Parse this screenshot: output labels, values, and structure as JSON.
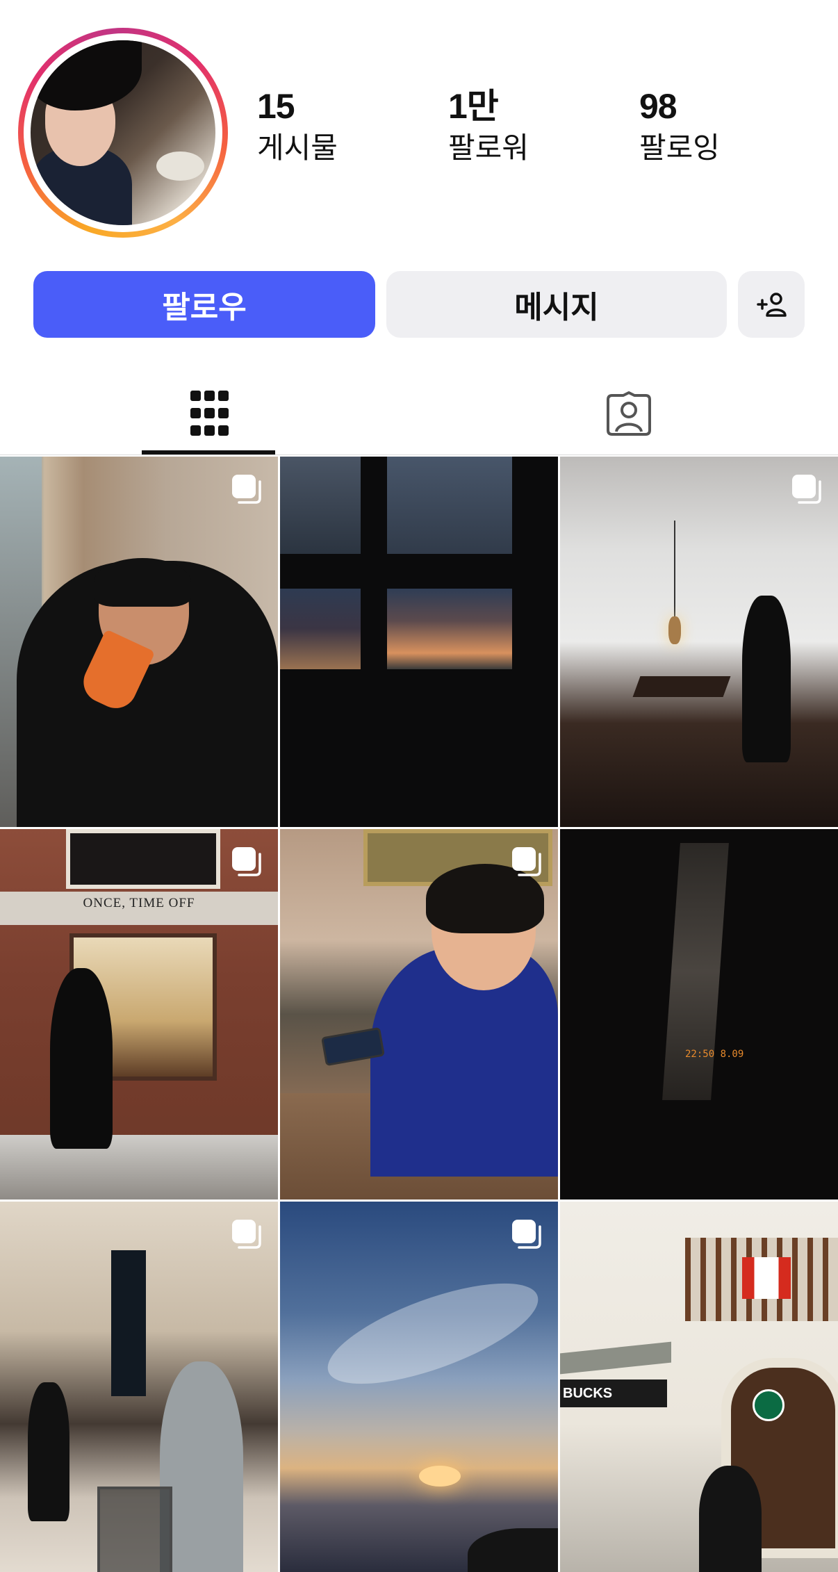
{
  "profile": {
    "stats": [
      {
        "value": "15",
        "label": "게시물"
      },
      {
        "value": "1만",
        "label": "팔로워"
      },
      {
        "value": "98",
        "label": "팔로잉"
      }
    ]
  },
  "actions": {
    "follow_label": "팔로우",
    "message_label": "메시지",
    "suggest_icon": "add-person-icon"
  },
  "tabs": [
    {
      "name": "posts",
      "icon": "grid-icon",
      "active": true
    },
    {
      "name": "tagged",
      "icon": "tagged-person-icon",
      "active": false
    }
  ],
  "posts": [
    {
      "desc_icon": "multi-photo-icon",
      "multiple": true
    },
    {
      "multiple": false
    },
    {
      "multiple": true
    },
    {
      "multiple": true,
      "sign_text": "ONCE, TIME OFF"
    },
    {
      "multiple": true
    },
    {
      "multiple": false,
      "clock_text": "22:50 8.09"
    },
    {
      "multiple": true
    },
    {
      "multiple": true
    },
    {
      "multiple": false,
      "store_text": "BUCKS"
    }
  ],
  "colors": {
    "follow_button": "#4a5df9",
    "secondary_button": "#efeff2"
  }
}
